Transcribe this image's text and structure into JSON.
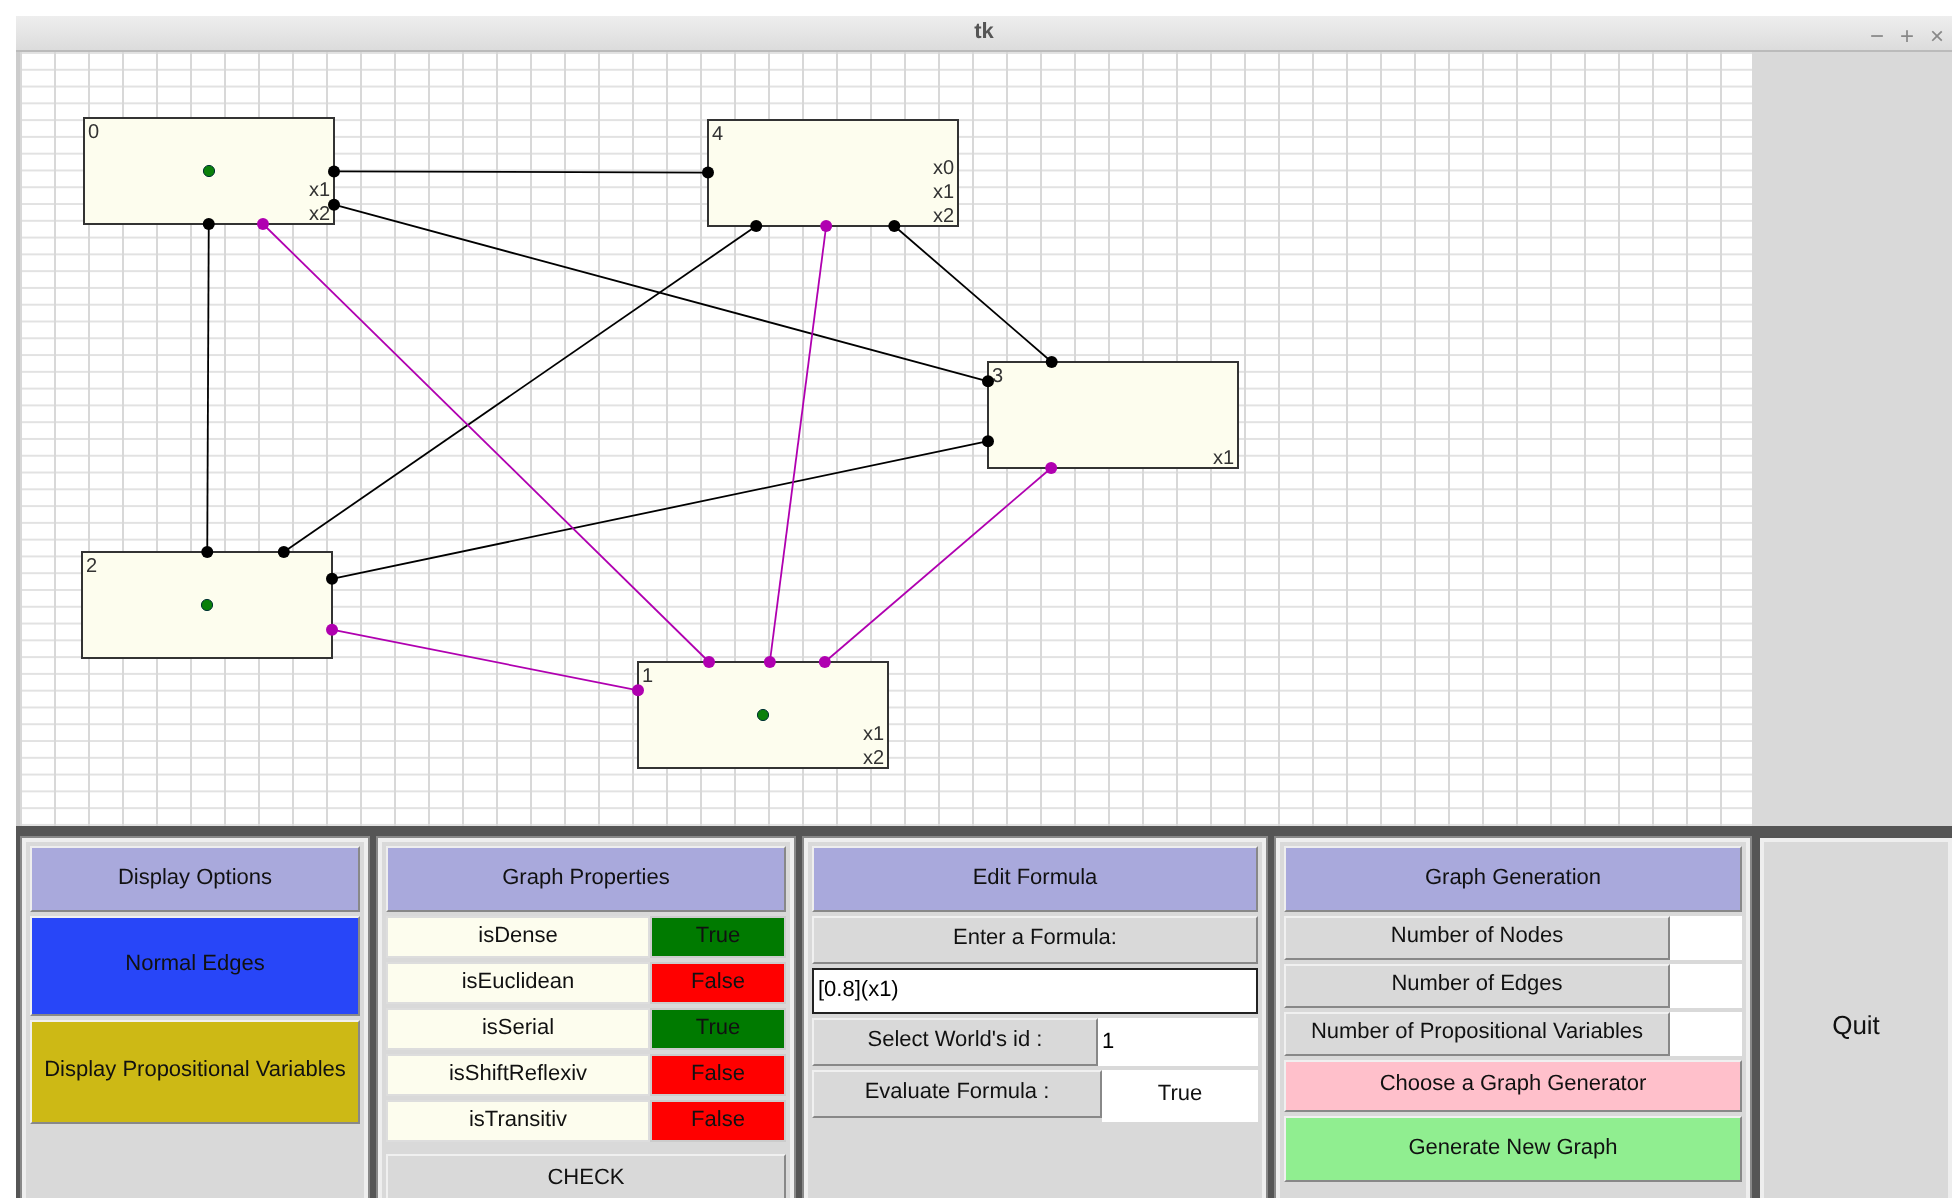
{
  "window": {
    "title": "tk",
    "controls": [
      "−",
      "+",
      "×"
    ]
  },
  "graph": {
    "nodes": [
      {
        "label": "0",
        "marked": true,
        "variables": [
          "x1",
          "x2"
        ]
      },
      {
        "label": "1",
        "marked": true,
        "variables": [
          "x1",
          "x2"
        ]
      },
      {
        "label": "2",
        "marked": true
      },
      {
        "label": "3",
        "marked": false,
        "variables": [
          "x1"
        ]
      },
      {
        "label": "4",
        "marked": false,
        "variables": [
          "x0",
          "x1",
          "x2"
        ]
      }
    ],
    "edges": [
      {
        "color": "#000000"
      },
      {
        "color": "#000000"
      },
      {
        "color": "#000000"
      },
      {
        "color": "#000000"
      },
      {
        "color": "#000000"
      },
      {
        "color": "#000000"
      },
      {
        "color": "#b000b0"
      },
      {
        "color": "#b000b0"
      },
      {
        "color": "#b000b0"
      },
      {
        "color": "#b000b0"
      }
    ]
  },
  "display_options": {
    "title": "Display Options",
    "buttons": [
      {
        "label": "Normal Edges",
        "color": "#2846f8"
      },
      {
        "label": "Display Propositional Variables",
        "color": "#cdb915"
      }
    ]
  },
  "graph_properties": {
    "title": "Graph Properties",
    "rows": [
      {
        "name": "isDense",
        "value": "True",
        "holds": true
      },
      {
        "name": "isEuclidean",
        "value": "False",
        "holds": false
      },
      {
        "name": "isSerial",
        "value": "True",
        "holds": true
      },
      {
        "name": "isShiftReflexiv",
        "value": "False",
        "holds": false
      },
      {
        "name": "isTransitiv",
        "value": "False",
        "holds": false
      }
    ],
    "check_button": "CHECK"
  },
  "edit_formula": {
    "title": "Edit Formula",
    "prompt": "Enter a Formula:",
    "formula": "[0.8](x1)",
    "world_label": "Select World's id :",
    "world_id": "1",
    "evaluate_label": "Evaluate Formula :",
    "result": "True"
  },
  "graph_generation": {
    "title": "Graph Generation",
    "fields": [
      {
        "label": "Number of Nodes"
      },
      {
        "label": "Number of Edges"
      },
      {
        "label": "Number of Propositional Variables"
      }
    ],
    "generator_button": "Choose a Graph Generator",
    "generate_button": "Generate New Graph"
  },
  "quit_button": "Quit"
}
